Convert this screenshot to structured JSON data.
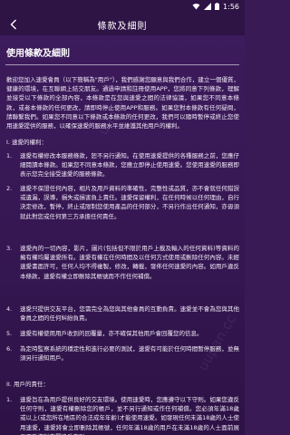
{
  "status_bar": {
    "time": "1:56"
  },
  "app_bar": {
    "title": "條款及細則"
  },
  "doc": {
    "heading": "使用條款及細則",
    "intro": "歡迎您加入速愛會員（以下簡稱為\"用戶\"），我們感謝您願意與我們合作，建立一個優質，健康的環境，在互聯網上結交朋友。通過申請和註冊使用APP，您將同意下列條款，理解並接受以下條款的全部內容，本條款是在您與速愛之間的法律協議，如果您不同意本條款，或者本條款的任何更改，請即時停止使用APP和服務。如果您對本條款有任何疑問，請聯繫我們。如果您不同意以下條款或本條款的任何更改，我們可以隨時暫停或終止您使用速愛提供的服務，以確保速愛的服務水平並維護其他用戶的權利。",
    "section1_title": "I. 速愛的權利：",
    "section1_items": [
      {
        "num": "1.",
        "text": "速愛有權修改本服務條款，恕不另行通知。在使用速愛提供的各種服務之前，您應仔細閱讀本條款。如果您不同意本條款，您應立即停止使用速愛。您使用速愛的服務即表示您完全接受速愛的服務條款。"
      },
      {
        "num": "2.",
        "text": "速愛不保證任何內容，相片及用戶資料的準確性，完整性或品質，亦不會就任何錯誤或遺漏，誤導，損失或損害負上責任。速愛保留權利，在任何時候以任何理由，自行決定修改，暫停，終止或限制您使用產品的任何部分，不另行作出任何通知，亦毋須就此對您或任何第三方承擔任何責任。"
      },
      {
        "num": "3.",
        "text": "速愛內的一切內容，影片，圖片(包括但不限於用戶上載及輸入的任何資料)等資料的擁有權均屬速愛所有。速愛有權在任何時間及以任何方式使用或刪除任何內容。未經速愛書面許可，任何人均不得複製，修改，轉載，發佈任何速愛的內容。如用戶違反本條款，速愛有權立即刪除其帳號而不作任何補償。"
      },
      {
        "num": "4.",
        "text": "速愛只提供交友平台，您需完全為您與其他會員的互動負責。速愛並不會為您與其他會員之間的任何糾紛負責。"
      },
      {
        "num": "5.",
        "text": "速愛有權使用用戶收到的回覆量，亦不確保其他用戶會回覆您的信息。"
      },
      {
        "num": "6.",
        "text": "為定時監察系統的穩定性和進行必要的測試，速愛有可能於任何時間暫停服務，並無須另行通知用戶。"
      }
    ],
    "section2_title": "II. 用戶的責任：",
    "section2_items": [
      {
        "num": "1.",
        "text": "速愛旨在為用戶提供良好的交友環境。使用速愛時，您應遵守以下守則。如果您違反任何守則，速愛有權刪除您的帳戶，並不另行通知或作任何補償。您必須年滿18歲或以上(或您所在地區的合法成年年齡)才能使用速愛。如發現任何未滿18歲的人士使用速愛，速愛將會立即刪除其帳號，任何年滿18歲的用戶在未滿18歲的人士面前展示不雅資料亦屬違反守則。"
      }
    ]
  },
  "watermark": "uupan.cc",
  "colors": {
    "bar": "#2e1345",
    "background": "#3a1a55",
    "text": "#f2eaf8"
  }
}
